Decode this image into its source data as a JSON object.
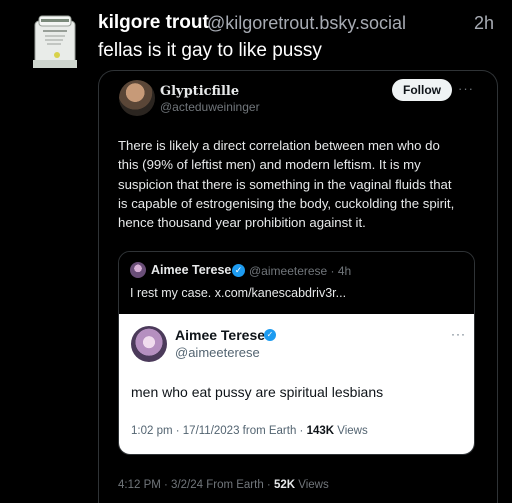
{
  "post": {
    "author_name": "kilgore trout",
    "author_handle": "@kilgoretrout.bsky.social",
    "time": "2h",
    "text": "fellas is it gay to like pussy"
  },
  "embedded_tweet": {
    "author_name": "Glypticfille",
    "author_handle": "@acteduweininger",
    "follow_label": "Follow",
    "more_label": "···",
    "body_lines": [
      "There is likely a direct correlation between men who do",
      "this (99% of leftist men) and modern leftism. It is my",
      "suspicion that there is something in the vaginal fluids that",
      "is capable of estrogenising the body, cuckolding the spirit,",
      "hence thousand year prohibition against it."
    ],
    "footer_prefix": "4:12 PM · 3/2/24 From Earth · ",
    "footer_views_count": "52K",
    "footer_views_label": " Views"
  },
  "quoted_tweet": {
    "author_name": "Aimee Terese",
    "author_handle": "@aimeeterese · 4h",
    "text": "I rest my case. x.com/kanescabdriv3r..."
  },
  "quoted_card": {
    "author_name": "Aimee Terese",
    "author_handle": "@aimeeterese",
    "more_label": "···",
    "text": "men who eat pussy are spiritual lesbians",
    "meta_prefix": "1:02 pm · 17/11/2023 from Earth · ",
    "views_count": "143K",
    "views_label": " Views"
  },
  "colors": {
    "background": "#000000",
    "verified_blue": "#1d9bf0",
    "muted_text": "#71767b"
  }
}
